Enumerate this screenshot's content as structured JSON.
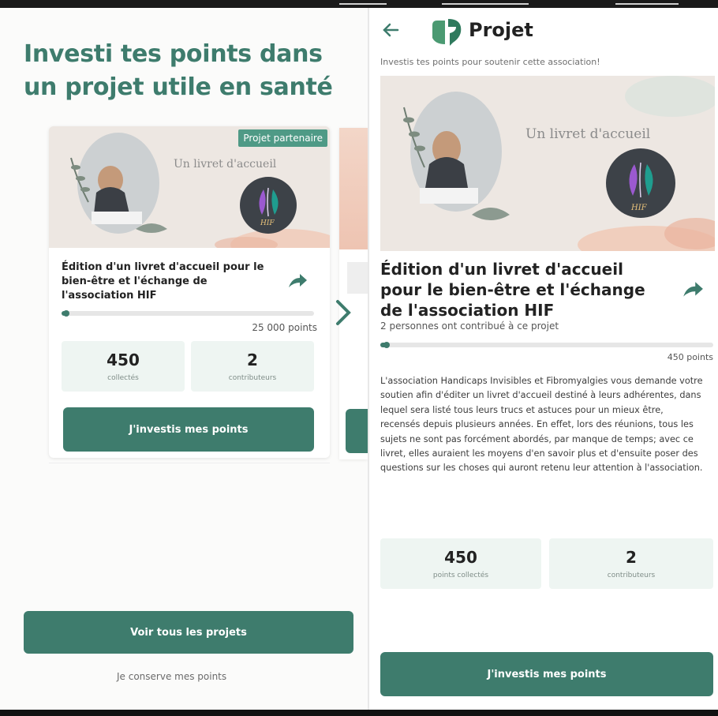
{
  "left": {
    "title": "Investi tes points dans un projet utile en santé",
    "card": {
      "badge": "Projet partenaire",
      "image_caption": "Un livret d'accueil",
      "image_logo": "HIF",
      "title": "Édition d'un livret d'accueil pour le bien-être et l'échange de l'association HIF",
      "goal": "25 000 points",
      "progress_fraction": 0.018,
      "stats": [
        {
          "value": "450",
          "label": "collectés"
        },
        {
          "value": "2",
          "label": "contributeurs"
        }
      ],
      "invest_button": "J'investis mes points"
    },
    "see_all_button": "Voir tous les projets",
    "keep_link": "Je conserve mes points"
  },
  "right": {
    "header_title": "Projet",
    "subtitle": "Investis tes points pour soutenir cette association!",
    "image_caption": "Un livret d'accueil",
    "image_logo": "HIF",
    "project_title": "Édition d'un livret d'accueil pour le bien-être et l'échange de l'association HIF",
    "contributors_text": "2 personnes ont contribué à ce projet",
    "progress_fraction": 0.018,
    "goal": "450 points",
    "description": "L'association Handicaps Invisibles et Fibromyalgies vous demande votre soutien afin d'éditer un livret d'accueil destiné à leurs adhérentes, dans lequel sera listé tous leurs trucs et astuces pour un mieux être, recensés depuis plusieurs années. En effet, lors des réunions, tous les sujets ne sont pas forcément abordés, par manque de temps; avec ce livret, elles auraient les moyens d'en savoir plus et d'ensuite poser des questions sur les choses qui auront retenu leur attention à l'association.",
    "stats": [
      {
        "value": "450",
        "label": "points collectés"
      },
      {
        "value": "2",
        "label": "contributeurs"
      }
    ],
    "invest_button": "J'investis mes points"
  },
  "colors": {
    "brand_green": "#3e7c6d",
    "badge_green": "#4f9a86",
    "stat_bg": "#eef5f2"
  },
  "icons": [
    "back-arrow-icon",
    "app-logo-icon",
    "share-icon",
    "chevron-right-icon",
    "hif-logo-icon"
  ]
}
